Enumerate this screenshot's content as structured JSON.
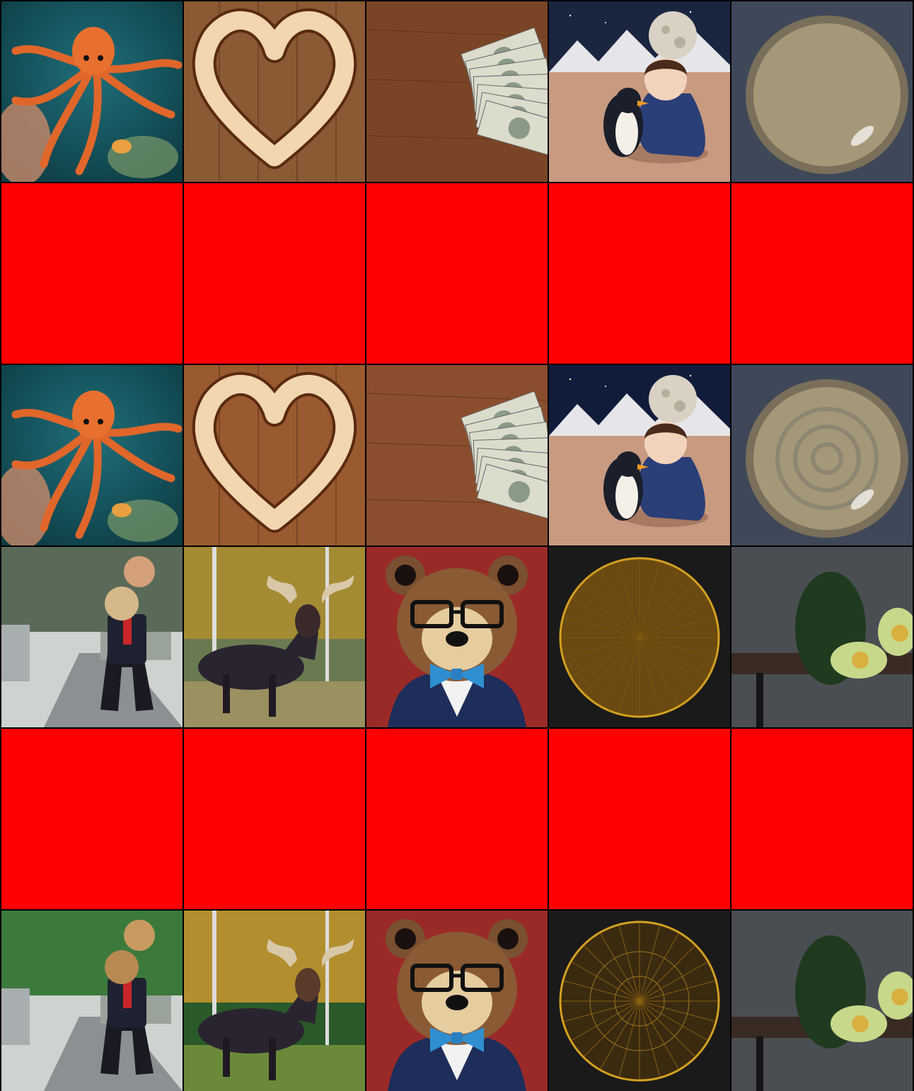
{
  "grid": {
    "rows": 6,
    "columns": 5,
    "placeholder_color": "#ff0000",
    "tiles": [
      {
        "kind": "image",
        "subject": "octopus-coral-reef",
        "style": "photo"
      },
      {
        "kind": "image",
        "subject": "wooden-heart-on-planks",
        "style": "photo"
      },
      {
        "kind": "image",
        "subject": "dollar-bills-on-table",
        "style": "photo"
      },
      {
        "kind": "image",
        "subject": "child-with-penguin-moon-desert",
        "style": "photo"
      },
      {
        "kind": "image",
        "subject": "ceramic-bowl",
        "style": "photo"
      },
      {
        "kind": "placeholder"
      },
      {
        "kind": "placeholder"
      },
      {
        "kind": "placeholder"
      },
      {
        "kind": "placeholder"
      },
      {
        "kind": "placeholder"
      },
      {
        "kind": "image",
        "subject": "octopus-coral-reef",
        "style": "illustrated"
      },
      {
        "kind": "image",
        "subject": "wooden-heart-on-planks",
        "style": "illustrated"
      },
      {
        "kind": "image",
        "subject": "dollar-bills-on-table",
        "style": "illustrated"
      },
      {
        "kind": "image",
        "subject": "child-with-penguin-moon-desert",
        "style": "illustrated"
      },
      {
        "kind": "image",
        "subject": "ceramic-bowl",
        "style": "illustrated"
      },
      {
        "kind": "image",
        "subject": "man-with-masks-on-street",
        "style": "photo"
      },
      {
        "kind": "image",
        "subject": "moose-in-autumn-forest",
        "style": "photo"
      },
      {
        "kind": "image",
        "subject": "bear-with-glasses-bowtie",
        "style": "photo"
      },
      {
        "kind": "image",
        "subject": "golden-circle-grid",
        "style": "photo"
      },
      {
        "kind": "image",
        "subject": "avocados-on-table",
        "style": "photo"
      },
      {
        "kind": "placeholder"
      },
      {
        "kind": "placeholder"
      },
      {
        "kind": "placeholder"
      },
      {
        "kind": "placeholder"
      },
      {
        "kind": "placeholder"
      },
      {
        "kind": "image",
        "subject": "man-with-masks-on-street",
        "style": "illustrated"
      },
      {
        "kind": "image",
        "subject": "moose-in-autumn-forest",
        "style": "illustrated"
      },
      {
        "kind": "image",
        "subject": "bear-with-glasses-bowtie",
        "style": "illustrated"
      },
      {
        "kind": "image",
        "subject": "golden-circle-grid",
        "style": "illustrated"
      },
      {
        "kind": "image",
        "subject": "avocados-on-table",
        "style": "illustrated"
      }
    ]
  }
}
